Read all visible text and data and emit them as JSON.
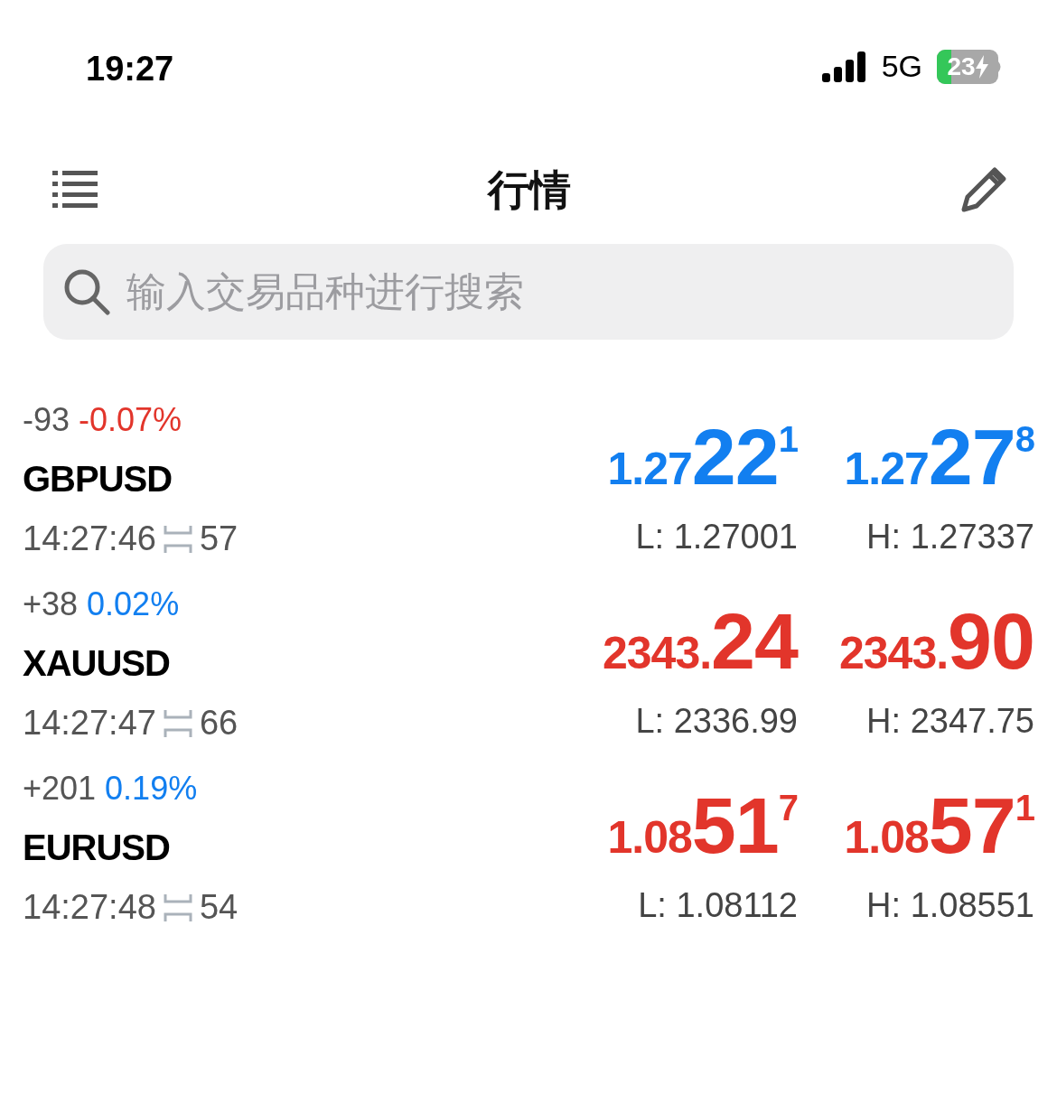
{
  "status_bar": {
    "time": "19:27",
    "network": "5G",
    "battery": "23"
  },
  "header": {
    "title": "行情"
  },
  "search": {
    "placeholder": "输入交易品种进行搜索"
  },
  "quotes": [
    {
      "change": "-93",
      "percent": "-0.07%",
      "up": false,
      "symbol": "GBPUSD",
      "time": "14:27:46",
      "spread": "57",
      "bid": {
        "prefix": "1.27",
        "big": "22",
        "sup": "1",
        "up": true
      },
      "ask": {
        "prefix": "1.27",
        "big": "27",
        "sup": "8",
        "up": true
      },
      "low": "L: 1.27001",
      "high": "H: 1.27337"
    },
    {
      "change": "+38",
      "percent": "0.02%",
      "up": true,
      "symbol": "XAUUSD",
      "time": "14:27:47",
      "spread": "66",
      "bid": {
        "prefix": "2343.",
        "big": "24",
        "up": false
      },
      "ask": {
        "prefix": "2343.",
        "big": "90",
        "up": false
      },
      "low": "L: 2336.99",
      "high": "H: 2347.75"
    },
    {
      "change": "+201",
      "percent": "0.19%",
      "up": true,
      "symbol": "EURUSD",
      "time": "14:27:48",
      "spread": "54",
      "bid": {
        "prefix": "1.08",
        "big": "51",
        "sup": "7",
        "up": false
      },
      "ask": {
        "prefix": "1.08",
        "big": "57",
        "sup": "1",
        "up": false
      },
      "low": "L: 1.08112",
      "high": "H: 1.08551"
    }
  ]
}
